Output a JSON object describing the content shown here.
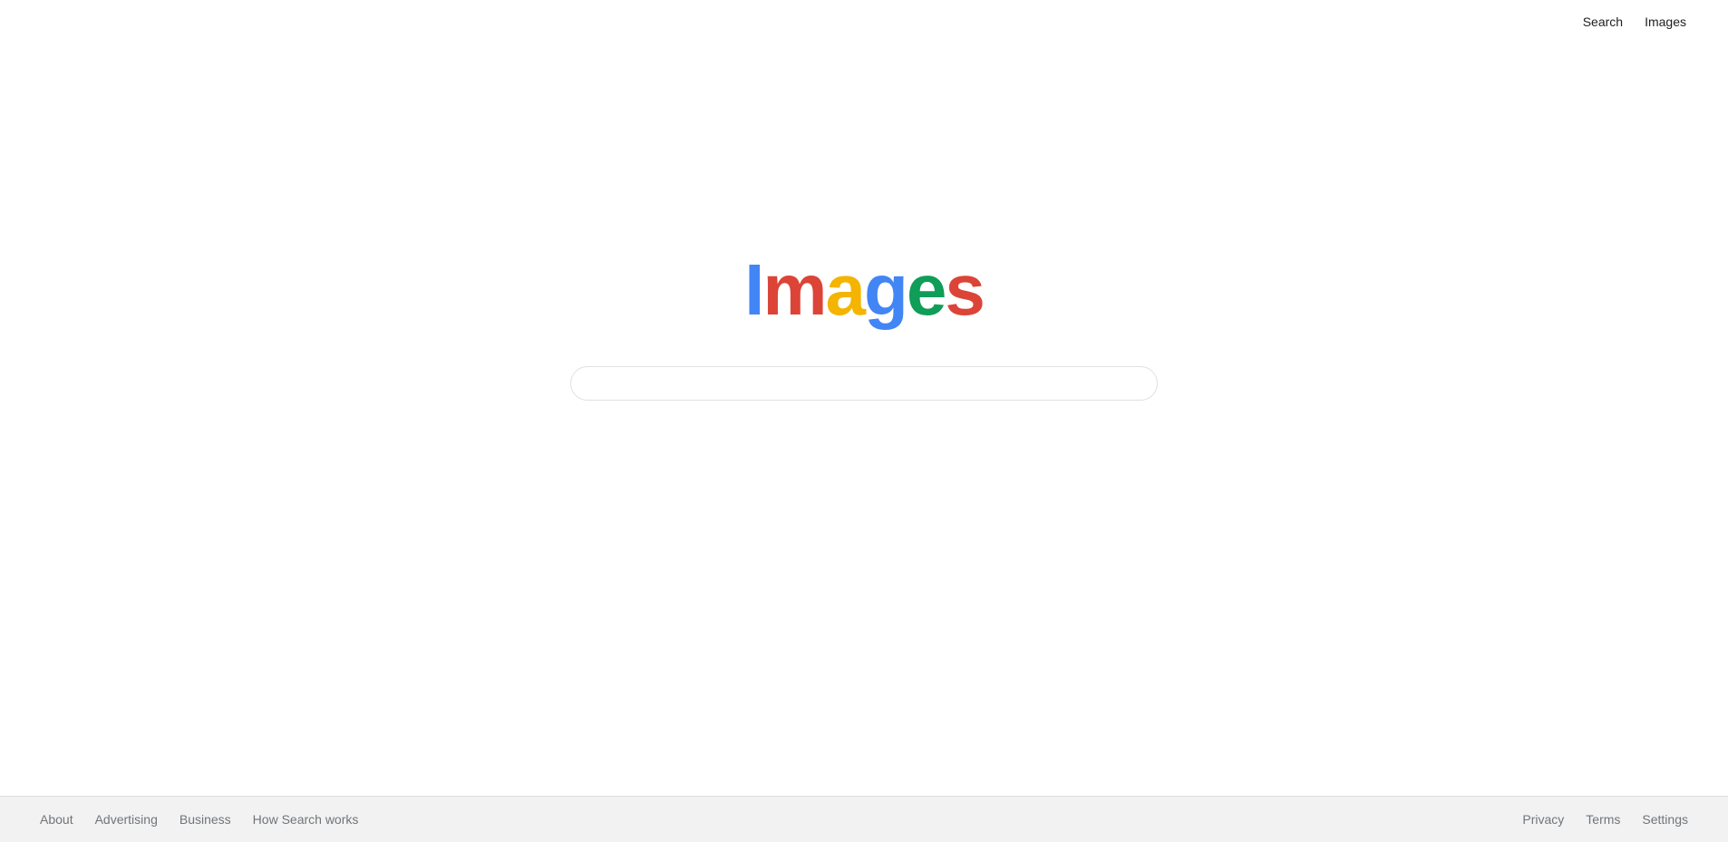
{
  "top_nav": {
    "search_label": "Search",
    "images_label": "Images"
  },
  "logo": {
    "letters": [
      {
        "char": "I",
        "color": "#4285f4"
      },
      {
        "char": "m",
        "color": "#db4437"
      },
      {
        "char": "a",
        "color": "#f4b400"
      },
      {
        "char": "g",
        "color": "#4285f4"
      },
      {
        "char": "e",
        "color": "#0f9d58"
      },
      {
        "char": "s",
        "color": "#db4437"
      }
    ]
  },
  "search": {
    "value": "",
    "placeholder": ""
  },
  "footer": {
    "left": [
      "About",
      "Advertising",
      "Business",
      "How Search works"
    ],
    "right": [
      "Privacy",
      "Terms",
      "Settings"
    ]
  },
  "colors": {
    "footer_bg": "#f2f2f2",
    "footer_text": "#70757a",
    "nav_text": "#202124"
  }
}
